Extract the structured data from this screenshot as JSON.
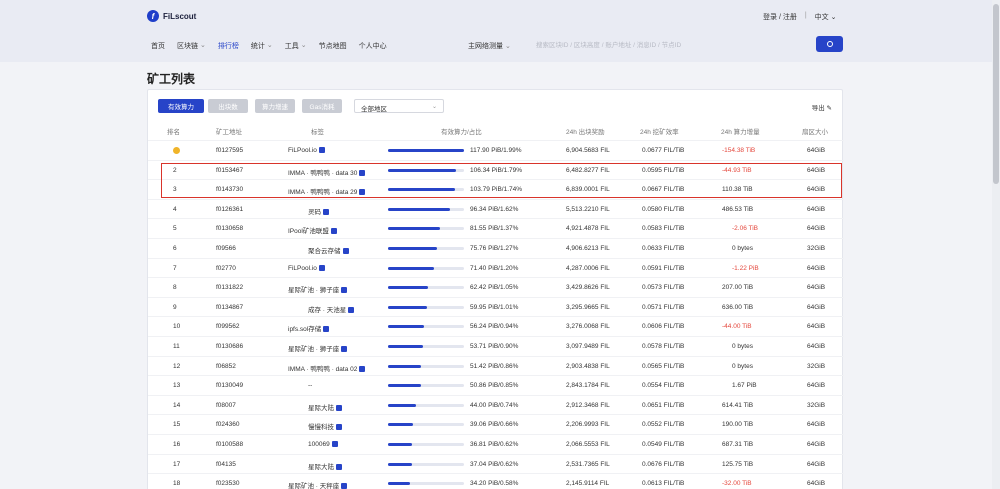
{
  "brand": {
    "name": "FiLscout"
  },
  "top_links": {
    "login": "登录 / 注册",
    "divider": "|",
    "language": "中文"
  },
  "nav": [
    "首页",
    "区块链",
    "排行榜",
    "统计",
    "工具",
    "节点地图",
    "个人中心"
  ],
  "network_select": "主网络测量",
  "search": {
    "placeholder": "搜索区块ID / 区块高度 / 账户地址 / 消息ID / 节点ID"
  },
  "page_title": "矿工列表",
  "toolbar": {
    "btn_primary": "有效算力",
    "btn_2": "出块数",
    "btn_3": "算力增速",
    "btn_4": "Gas消耗",
    "region": "全部地区",
    "export": "导出"
  },
  "table": {
    "headers": [
      "排名",
      "矿工地址",
      "标签",
      "有效算力/占比",
      "24h 出块奖励",
      "24h 挖矿效率",
      "24h 算力增量",
      "扇区大小"
    ],
    "rows": [
      {
        "rank": "",
        "medal": true,
        "address": "f0127595",
        "tag": "FiLPool.io",
        "verified": true,
        "power": "117.90 PiB/1.99%",
        "bar": 1.0,
        "reward": "6,904.5683 FIL",
        "eff": "0.0677 FIL/TiB",
        "delta": "-154.38 TiB",
        "neg": true,
        "sector": "64GiB"
      },
      {
        "rank": "2",
        "medal": false,
        "address": "f0153467",
        "tag": "IMMA · 鸭鸭鸭 · data 30",
        "verified": true,
        "power": "106.34 PiB/1.79%",
        "bar": 0.9,
        "reward": "6,482.8277 FIL",
        "eff": "0.0595 FIL/TiB",
        "delta": "-44.93 TiB",
        "neg": true,
        "sector": "64GiB"
      },
      {
        "rank": "3",
        "medal": false,
        "address": "f0143730",
        "tag": "IMMA · 鸭鸭鸭 · data 29",
        "verified": true,
        "power": "103.79 PiB/1.74%",
        "bar": 0.88,
        "reward": "6,839.0001 FIL",
        "eff": "0.0667 FIL/TiB",
        "delta": "110.38 TiB",
        "neg": false,
        "sector": "64GiB"
      },
      {
        "rank": "4",
        "medal": false,
        "address": "f0126361",
        "tag": "灵码",
        "verified": true,
        "power": "96.34 PiB/1.62%",
        "bar": 0.82,
        "reward": "5,513.2210 FIL",
        "eff": "0.0580 FIL/TiB",
        "delta": "486.53 TiB",
        "neg": false,
        "sector": "64GiB"
      },
      {
        "rank": "5",
        "medal": false,
        "address": "f0130658",
        "tag": "IPool矿池联盟",
        "verified": true,
        "power": "81.55 PiB/1.37%",
        "bar": 0.69,
        "reward": "4,921.4878 FIL",
        "eff": "0.0583 FIL/TiB",
        "delta": "-2.06 TiB",
        "neg": true,
        "sector": "64GiB"
      },
      {
        "rank": "6",
        "medal": false,
        "address": "f09566",
        "tag": "聚合云存储",
        "verified": true,
        "power": "75.76 PiB/1.27%",
        "bar": 0.64,
        "reward": "4,906.6213 FIL",
        "eff": "0.0633 FIL/TiB",
        "delta": "0 bytes",
        "neg": false,
        "sector": "32GiB"
      },
      {
        "rank": "7",
        "medal": false,
        "address": "f02770",
        "tag": "FiLPool.io",
        "verified": true,
        "power": "71.40 PiB/1.20%",
        "bar": 0.61,
        "reward": "4,287.0006 FIL",
        "eff": "0.0591 FIL/TiB",
        "delta": "-1.22 PiB",
        "neg": true,
        "sector": "64GiB"
      },
      {
        "rank": "8",
        "medal": false,
        "address": "f0131822",
        "tag": "星际矿池 · 狮子座",
        "verified": true,
        "power": "62.42 PiB/1.05%",
        "bar": 0.53,
        "reward": "3,429.8626 FIL",
        "eff": "0.0573 FIL/TiB",
        "delta": "207.00 TiB",
        "neg": false,
        "sector": "64GiB"
      },
      {
        "rank": "9",
        "medal": false,
        "address": "f0134867",
        "tag": "成存 · 天池星",
        "verified": true,
        "power": "59.95 PiB/1.01%",
        "bar": 0.51,
        "reward": "3,295.9665 FIL",
        "eff": "0.0571 FIL/TiB",
        "delta": "636.00 TiB",
        "neg": false,
        "sector": "64GiB"
      },
      {
        "rank": "10",
        "medal": false,
        "address": "f099562",
        "tag": "ipfs.sol存储",
        "verified": true,
        "power": "56.24 PiB/0.94%",
        "bar": 0.48,
        "reward": "3,276.0068 FIL",
        "eff": "0.0606 FIL/TiB",
        "delta": "-44.00 TiB",
        "neg": true,
        "sector": "64GiB"
      },
      {
        "rank": "11",
        "medal": false,
        "address": "f0130686",
        "tag": "星际矿池 · 狮子座",
        "verified": true,
        "power": "53.71 PiB/0.90%",
        "bar": 0.46,
        "reward": "3,097.9489 FIL",
        "eff": "0.0578 FIL/TiB",
        "delta": "0 bytes",
        "neg": false,
        "sector": "64GiB"
      },
      {
        "rank": "12",
        "medal": false,
        "address": "f06852",
        "tag": "IMMA · 鸭鸭鸭 · data 02",
        "verified": true,
        "power": "51.42 PiB/0.86%",
        "bar": 0.44,
        "reward": "2,903.4838 FIL",
        "eff": "0.0565 FIL/TiB",
        "delta": "0 bytes",
        "neg": false,
        "sector": "32GiB"
      },
      {
        "rank": "13",
        "medal": false,
        "address": "f0130049",
        "tag": "--",
        "verified": false,
        "power": "50.86 PiB/0.85%",
        "bar": 0.43,
        "reward": "2,843.1784 FIL",
        "eff": "0.0554 FIL/TiB",
        "delta": "1.67 PiB",
        "neg": false,
        "sector": "64GiB"
      },
      {
        "rank": "14",
        "medal": false,
        "address": "f08007",
        "tag": "星际大陆",
        "verified": true,
        "power": "44.00 PiB/0.74%",
        "bar": 0.37,
        "reward": "2,912.3468 FIL",
        "eff": "0.0651 FIL/TiB",
        "delta": "614.41 TiB",
        "neg": false,
        "sector": "32GiB"
      },
      {
        "rank": "15",
        "medal": false,
        "address": "f024360",
        "tag": "慢慢科技",
        "verified": true,
        "power": "39.06 PiB/0.66%",
        "bar": 0.33,
        "reward": "2,206.9993 FIL",
        "eff": "0.0552 FIL/TiB",
        "delta": "190.00 TiB",
        "neg": false,
        "sector": "64GiB"
      },
      {
        "rank": "16",
        "medal": false,
        "address": "f0100588",
        "tag": "100069",
        "verified": true,
        "power": "36.81 PiB/0.62%",
        "bar": 0.31,
        "reward": "2,066.5553 FIL",
        "eff": "0.0549 FIL/TiB",
        "delta": "687.31 TiB",
        "neg": false,
        "sector": "64GiB"
      },
      {
        "rank": "17",
        "medal": false,
        "address": "f04135",
        "tag": "星际大陆",
        "verified": true,
        "power": "37.04 PiB/0.62%",
        "bar": 0.31,
        "reward": "2,531.7365 FIL",
        "eff": "0.0676 FIL/TiB",
        "delta": "125.75 TiB",
        "neg": false,
        "sector": "64GiB"
      },
      {
        "rank": "18",
        "medal": false,
        "address": "f023530",
        "tag": "星际矿池 · 天秤座",
        "verified": true,
        "power": "34.20 PiB/0.58%",
        "bar": 0.29,
        "reward": "2,145.9114 FIL",
        "eff": "0.0613 FIL/TiB",
        "delta": "-32.00 TiB",
        "neg": true,
        "sector": "64GiB"
      }
    ]
  },
  "colors": {
    "accent": "#2744c8",
    "negative": "#e4473c",
    "highlight_box": "#d9342b"
  }
}
